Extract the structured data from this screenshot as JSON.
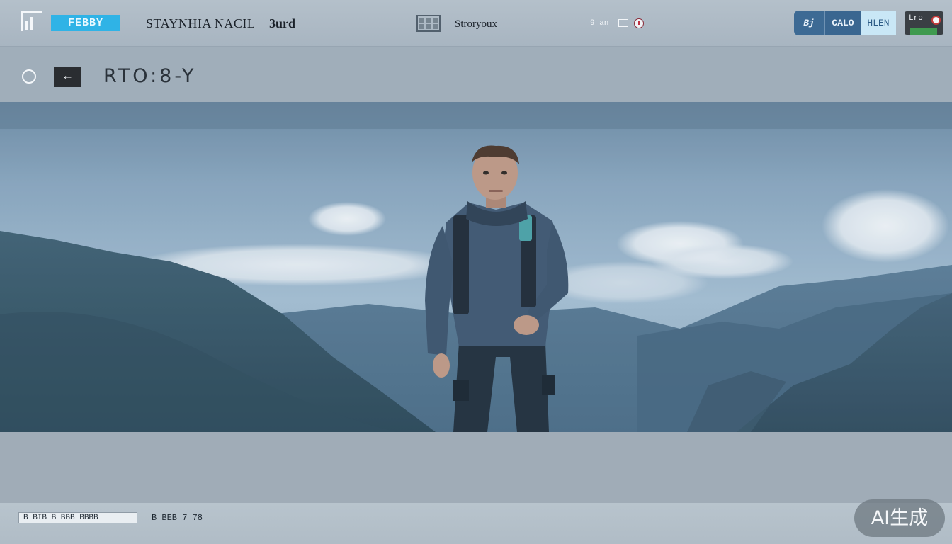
{
  "topbar": {
    "brand_badge": "FEBBY",
    "nav_title": "STAYNHIA NACIL",
    "nav_suffix": "3urd",
    "nav_center": "Stroryoux",
    "status_text": "9 an",
    "segments": [
      "Bj",
      "CALO",
      "HLEN"
    ],
    "corner_label": "Lro"
  },
  "header": {
    "title": "RTO:8-Y"
  },
  "footer": {
    "left_field": "B BIB B BBB BBBB",
    "mid_text": "B BEB 7 78"
  },
  "badge": {
    "label": "AI生成"
  },
  "colors": {
    "brand": "#2fb3e6",
    "segment_active": "#3d6a94",
    "segment_light": "#c9e7f6",
    "topbar_bg": "#b4c0ca"
  }
}
